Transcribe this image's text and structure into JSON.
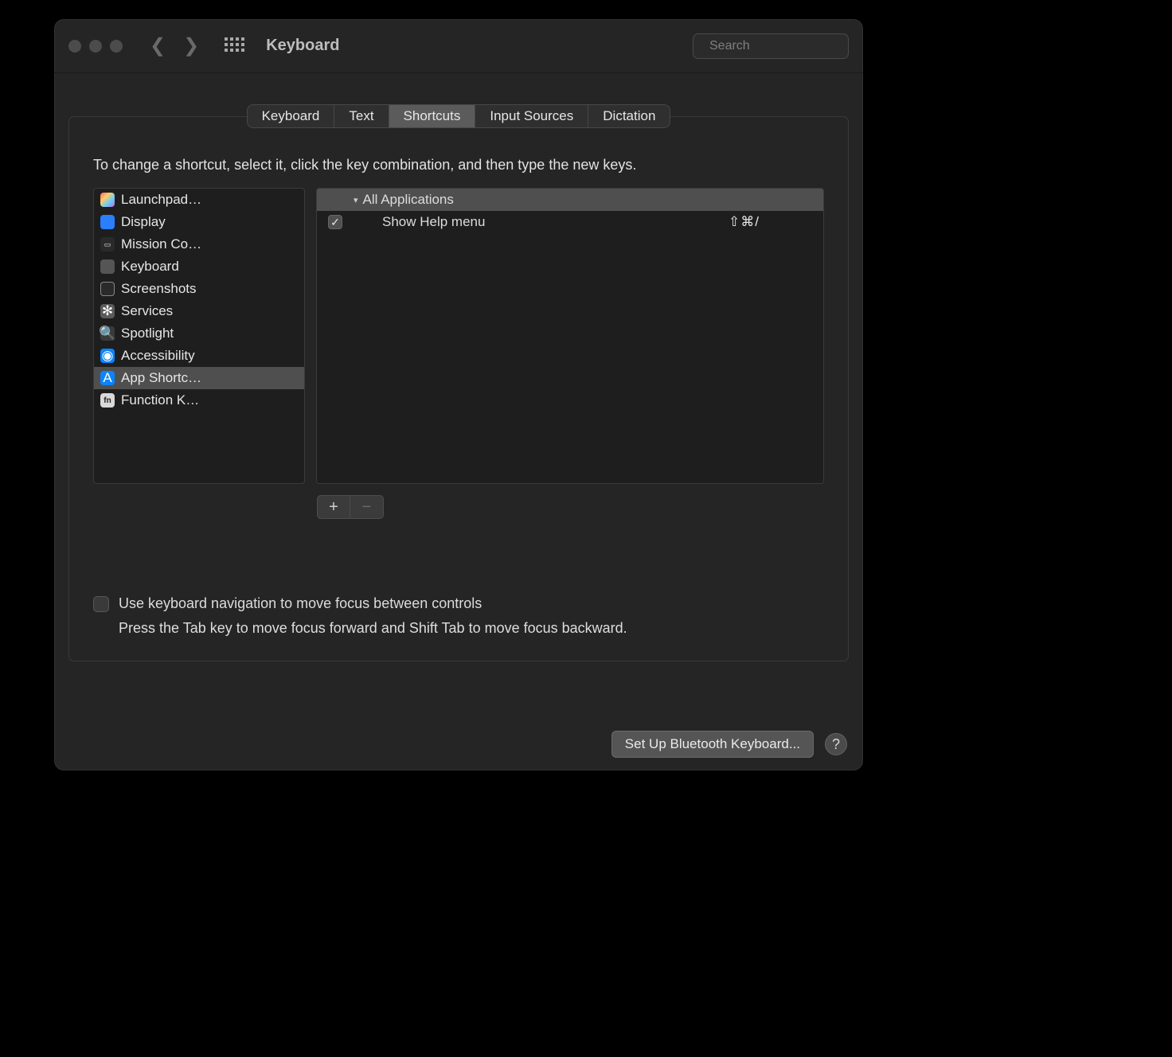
{
  "window": {
    "title": "Keyboard",
    "search_placeholder": "Search"
  },
  "tabs": [
    {
      "label": "Keyboard",
      "selected": false
    },
    {
      "label": "Text",
      "selected": false
    },
    {
      "label": "Shortcuts",
      "selected": true
    },
    {
      "label": "Input Sources",
      "selected": false
    },
    {
      "label": "Dictation",
      "selected": false
    }
  ],
  "instruction": "To change a shortcut, select it, click the key combination, and then type the new keys.",
  "categories": [
    {
      "icon": "ic-launchpad",
      "label": "Launchpad…",
      "selected": false
    },
    {
      "icon": "ic-display",
      "label": "Display",
      "selected": false
    },
    {
      "icon": "ic-mission",
      "label": "Mission Co…",
      "selected": false
    },
    {
      "icon": "ic-keyboard",
      "label": "Keyboard",
      "selected": false
    },
    {
      "icon": "ic-screenshots",
      "label": "Screenshots",
      "selected": false
    },
    {
      "icon": "ic-services",
      "label": "Services",
      "selected": false
    },
    {
      "icon": "ic-spotlight",
      "label": "Spotlight",
      "selected": false
    },
    {
      "icon": "ic-accessibility",
      "label": "Accessibility",
      "selected": false
    },
    {
      "icon": "ic-appshort",
      "label": "App Shortc…",
      "selected": true
    },
    {
      "icon": "ic-fn",
      "label": "Function K…",
      "selected": false
    }
  ],
  "right_panel": {
    "group_label": "All Applications",
    "items": [
      {
        "checked": true,
        "label": "Show Help menu",
        "shortcut": "⇧⌘/"
      }
    ]
  },
  "buttons": {
    "add": "+",
    "remove": "−"
  },
  "keyboard_nav": {
    "check_label": "Use keyboard navigation to move focus between controls",
    "sub_label": "Press the Tab key to move focus forward and Shift Tab to move focus backward."
  },
  "bottom": {
    "bluetooth": "Set Up Bluetooth Keyboard...",
    "help": "?"
  }
}
